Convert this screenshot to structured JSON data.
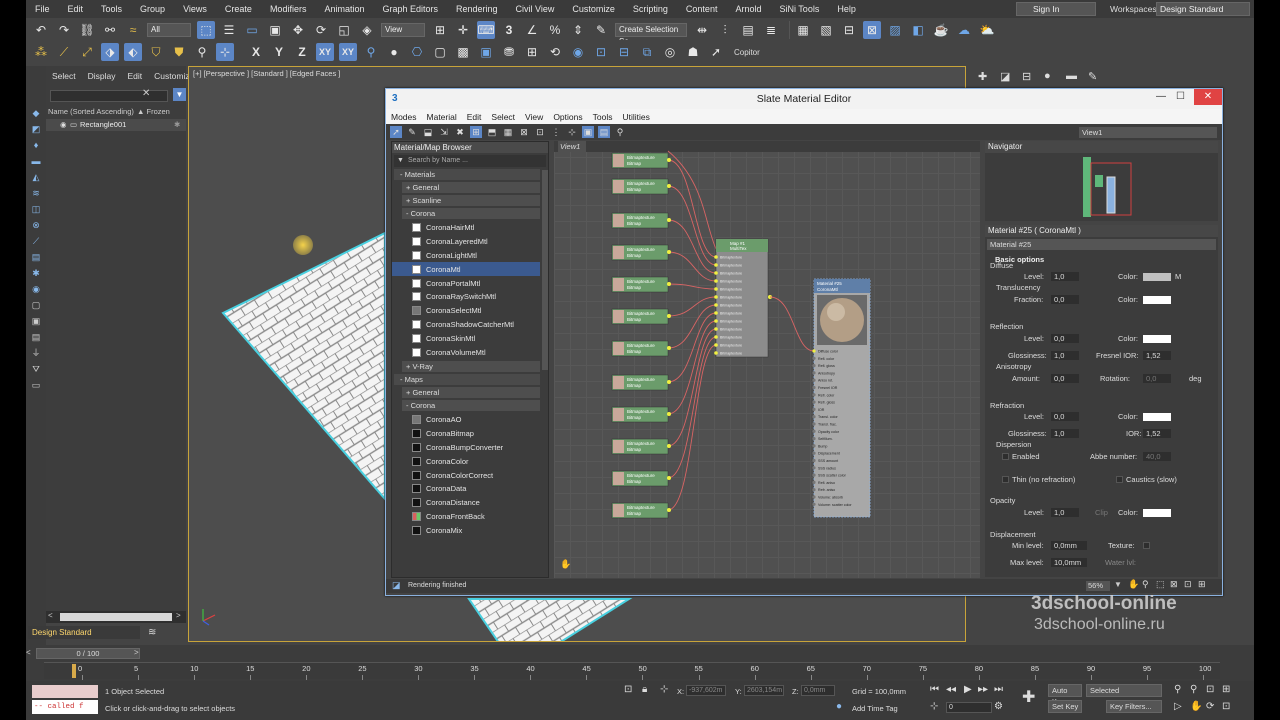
{
  "menu": [
    "File",
    "Edit",
    "Tools",
    "Group",
    "Views",
    "Create",
    "Modifiers",
    "Animation",
    "Graph Editors",
    "Rendering",
    "Civil View",
    "Customize",
    "Scripting",
    "Content",
    "Arnold",
    "SiNi Tools",
    "Help"
  ],
  "sign_in": "Sign In",
  "workspaces_label": "Workspaces:",
  "workspace_value": "Design Standard",
  "toolbar": {
    "filter_value": "All",
    "view_value": "View",
    "selection_set": "Create Selection Se",
    "axis_x": "X",
    "axis_y": "Y",
    "axis_z": "Z",
    "axis_xy": "XY",
    "axis_xy2": "XY",
    "copitor": "Copitor"
  },
  "explorer": {
    "tabs": [
      "Select",
      "Display",
      "Edit",
      "Customize"
    ],
    "column_name": "Name (Sorted Ascending)",
    "column_frozen": "▲ Frozen",
    "row": "Rectangle001",
    "workspace_bottom": "Design Standard"
  },
  "viewport": {
    "label": "[+] [Perspective ] [Standard ] [Edged Faces ]"
  },
  "slate": {
    "title": "Slate Material Editor",
    "menu": [
      "Modes",
      "Material",
      "Edit",
      "Select",
      "View",
      "Options",
      "Tools",
      "Utilities"
    ],
    "view_dropdown": "View1",
    "browser": {
      "title": "Material/Map Browser",
      "search": "Search by Name ...",
      "materials_header": "- Materials",
      "general": "+ General",
      "scanline": "+ Scanline",
      "corona": "- Corona",
      "materials": [
        "CoronaHairMtl",
        "CoronaLayeredMtl",
        "CoronaLightMtl",
        "CoronaMtl",
        "CoronaPortalMtl",
        "CoronaRaySwitchMtl",
        "CoronaSelectMtl",
        "CoronaShadowCatcherMtl",
        "CoronaSkinMtl",
        "CoronaVolumeMtl"
      ],
      "vray": "+ V-Ray",
      "maps_header": "- Maps",
      "maps_general": "+ General",
      "maps_corona": "- Corona",
      "maps": [
        "CoronaAO",
        "CoronaBitmap",
        "CoronaBumpConverter",
        "CoronaColor",
        "CoronaColorCorrect",
        "CoronaData",
        "CoronaDistance",
        "CoronaFrontBack",
        "CoronaMix"
      ]
    },
    "view_tab": "View1",
    "navigator_title": "Navigator",
    "node_bitmap_title": "Bitmaptexture",
    "node_bitmap_sub": "Bitmap",
    "node_multi_title": "Map #1",
    "node_multi_sub": "MultiTex",
    "node_multi_slot": "Bitmaptexture",
    "node_mat_title": "Material #25",
    "node_mat_sub": "CoronaMtl",
    "node_mat_slots": [
      "Diffuse color",
      "Refl. color",
      "Refl. gloss",
      "Anisotropy",
      "Aniso rot.",
      "Fresnel IOR",
      "Refr. color",
      "Refr. gloss",
      "IOR",
      "Transl. color",
      "Transl. frac.",
      "Opacity color",
      "Selfillum.",
      "Bump",
      "Displacement",
      "SSS amount",
      "SSS radius",
      "SSS scatter color",
      "Refl. aniso",
      "Refr. aniso",
      "Volume: absorb",
      "Volume: scatter color"
    ],
    "props": {
      "title": "Material #25  ( CoronaMtl )",
      "name": "Material #25",
      "basic_options": "Basic options",
      "diffuse": "Diffuse",
      "level": "Level:",
      "diffuse_level": "1,0",
      "color": "Color:",
      "m": "M",
      "translucency": "Translucency",
      "fraction": "Fraction:",
      "fraction_val": "0,0",
      "reflection": "Reflection",
      "refl_level": "0,0",
      "glossiness": "Glossiness:",
      "refl_gloss": "1,0",
      "fresnel": "Fresnel IOR:",
      "fresnel_val": "1,52",
      "anisotropy": "Anisotropy",
      "amount": "Amount:",
      "aniso_amount": "0,0",
      "rotation": "Rotation:",
      "rotation_val": "0,0",
      "deg": "deg",
      "refraction": "Refraction",
      "refr_level": "0,0",
      "refr_gloss": "1,0",
      "ior": "IOR:",
      "ior_val": "1,52",
      "dispersion": "Dispersion",
      "enabled": "Enabled",
      "abbe": "Abbe number:",
      "abbe_val": "40,0",
      "thin": "Thin (no refraction)",
      "caustics": "Caustics (slow)",
      "opacity": "Opacity",
      "opacity_level": "1,0",
      "clip": "Clip",
      "displacement": "Displacement",
      "min_level": "Min level:",
      "min_val": "0,0mm",
      "texture": "Texture:",
      "max_level": "Max level:",
      "max_val": "10,0mm",
      "water": "Water lvl:"
    },
    "status": "Rendering finished",
    "zoom": "56%"
  },
  "watermark": {
    "line1": "3dschool-online",
    "line2": "3dschool-online.ru"
  },
  "timeline": {
    "frame": "0 / 100",
    "ticks": [
      0,
      5,
      10,
      15,
      20,
      25,
      30,
      35,
      40,
      45,
      50,
      55,
      60,
      65,
      70,
      75,
      80,
      85,
      90,
      95,
      100
    ]
  },
  "status_bar": {
    "maxscript": "-- called f",
    "selected": "1 Object Selected",
    "hint": "Click or click-and-drag to select objects",
    "x_label": "X:",
    "x_val": "-937,602m",
    "y_label": "Y:",
    "y_val": "2603,154m",
    "z_label": "Z:",
    "z_val": "0,0mm",
    "grid": "Grid = 100,0mm",
    "add_time_tag": "Add Time Tag",
    "auto_key": "Auto Key",
    "selected_dd": "Selected",
    "set_key": "Set Key",
    "key_filters": "Key Filters...",
    "frame_field": "0"
  }
}
